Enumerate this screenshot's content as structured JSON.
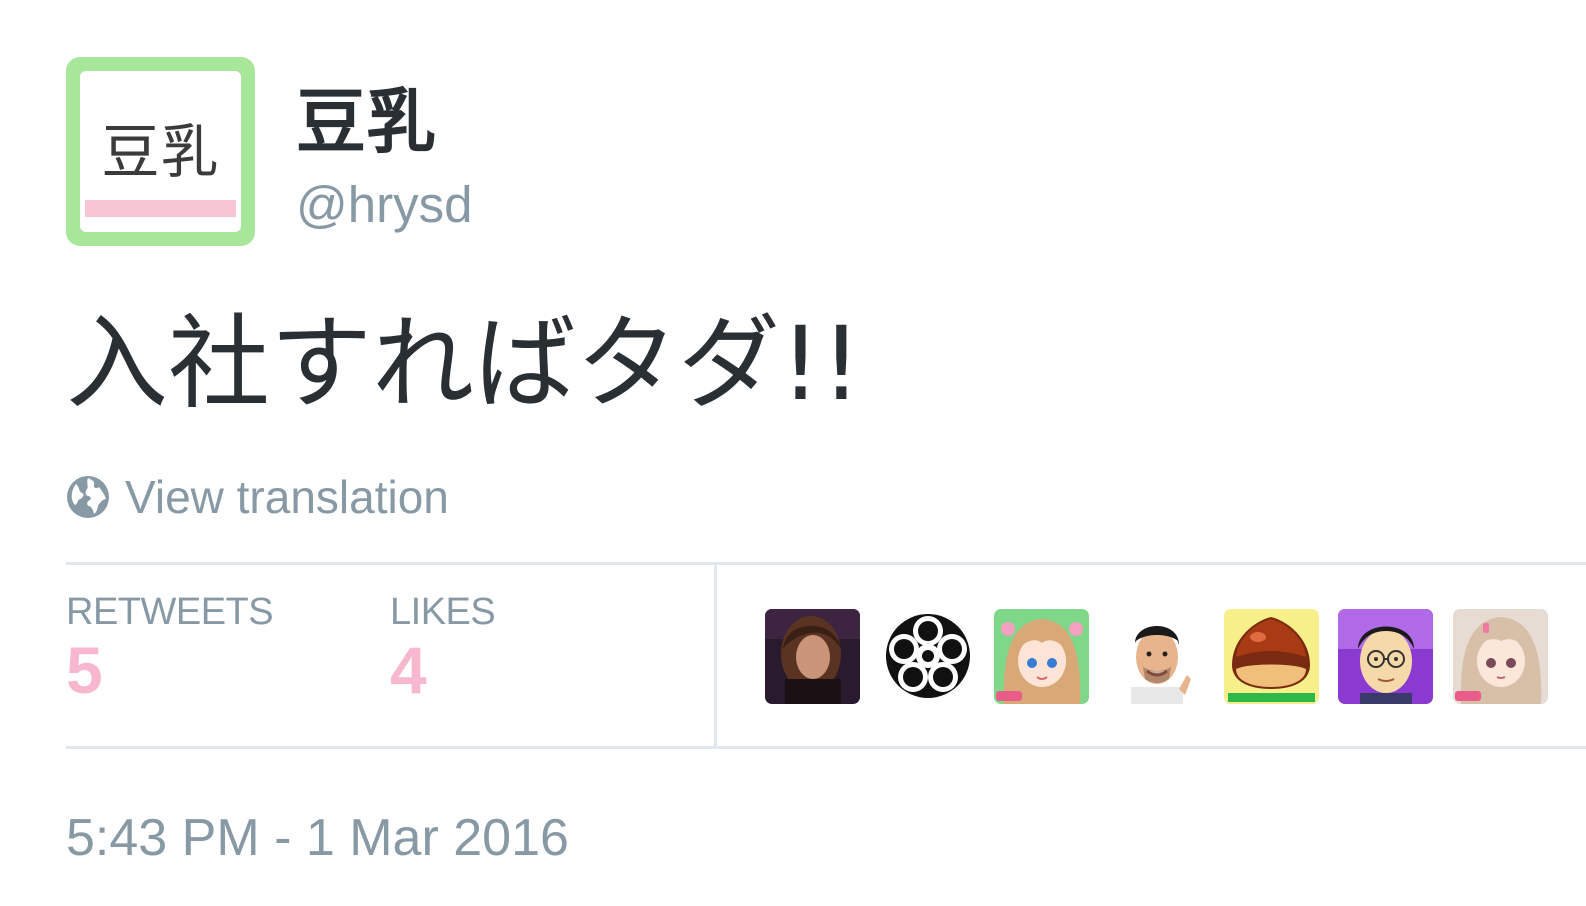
{
  "tweet": {
    "avatar_text": "豆乳",
    "display_name": "豆乳",
    "handle": "@hrysd",
    "text": "入社すればタダ!!",
    "translate_label": "View translation",
    "timestamp": "5:43 PM - 1 Mar 2016"
  },
  "stats": {
    "retweets_label": "RETWEETS",
    "retweets_count": "5",
    "likes_label": "LIKES",
    "likes_count": "4"
  },
  "liker_avatars": [
    {
      "name": "liker-avatar-1"
    },
    {
      "name": "liker-avatar-2"
    },
    {
      "name": "liker-avatar-3"
    },
    {
      "name": "liker-avatar-4"
    },
    {
      "name": "liker-avatar-5"
    },
    {
      "name": "liker-avatar-6"
    },
    {
      "name": "liker-avatar-7"
    }
  ],
  "colors": {
    "text_primary": "#292f33",
    "text_secondary": "#8899a6",
    "count_accent": "#f7b8cf",
    "divider": "#e1e8ed",
    "avatar_border": "#a8e69a",
    "avatar_stripe": "#f8c5d4"
  },
  "icons": {
    "translate": "globe-icon"
  }
}
